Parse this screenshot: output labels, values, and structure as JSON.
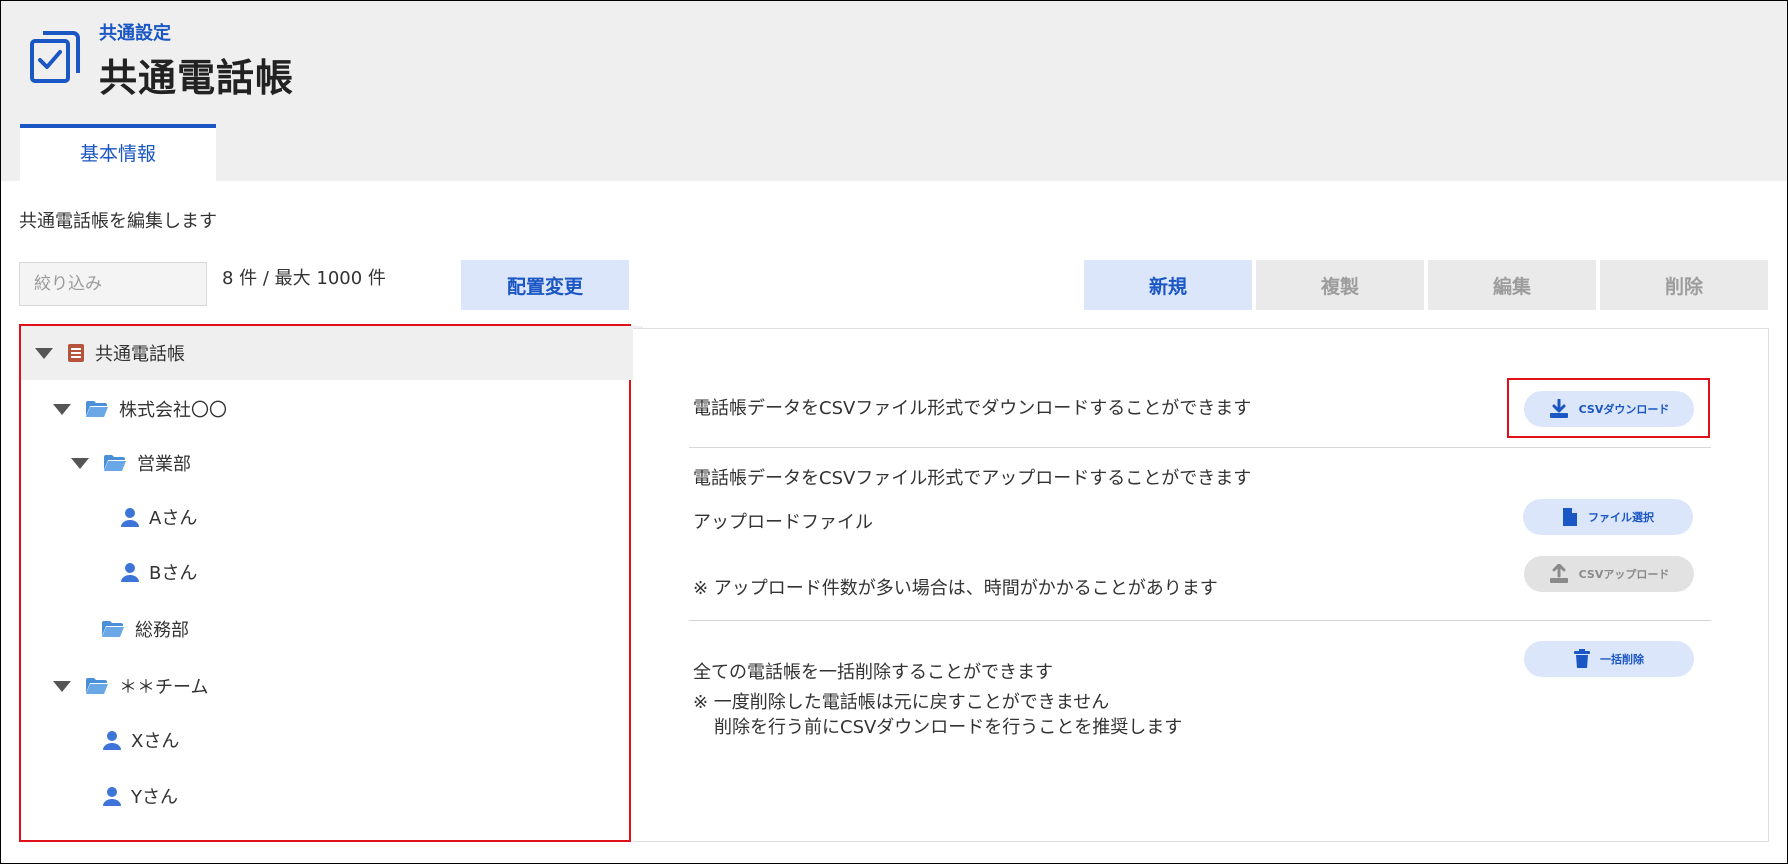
{
  "header": {
    "breadcrumb": "共通設定",
    "title": "共通電話帳"
  },
  "tabs": [
    {
      "label": "基本情報",
      "active": true
    }
  ],
  "description": "共通電話帳を編集します",
  "filter": {
    "placeholder": "絞り込み",
    "value": ""
  },
  "count_text": "8 件 / 最大 1000 件",
  "toolbar": {
    "rearrange_label": "配置変更",
    "new_label": "新規",
    "duplicate_label": "複製",
    "edit_label": "編集",
    "delete_label": "削除"
  },
  "tree": {
    "root": {
      "label": "共通電話帳",
      "icon": "book-icon"
    },
    "company": {
      "label": "株式会社〇〇",
      "icon": "folder-open-icon"
    },
    "sales": {
      "label": "営業部",
      "icon": "folder-open-icon"
    },
    "person_a": {
      "label": "Aさん",
      "icon": "person-icon"
    },
    "person_b": {
      "label": "Bさん",
      "icon": "person-icon"
    },
    "general_affairs": {
      "label": "総務部",
      "icon": "folder-open-icon"
    },
    "team": {
      "label": "＊＊チーム",
      "icon": "folder-open-icon"
    },
    "person_x": {
      "label": "Xさん",
      "icon": "person-icon"
    },
    "person_y": {
      "label": "Yさん",
      "icon": "person-icon"
    }
  },
  "panel": {
    "download_text": "電話帳データをCSVファイル形式でダウンロードすることができます",
    "download_button": "CSVダウンロード",
    "upload_text": "電話帳データをCSVファイル形式でアップロードすることができます",
    "upload_file_label": "アップロードファイル",
    "file_select_button": "ファイル選択",
    "upload_note": "※ アップロード件数が多い場合は、時間がかかることがあります",
    "upload_button": "CSVアップロード",
    "bulk_delete_text": "全ての電話帳を一括削除することができます",
    "bulk_delete_note1": "※ 一度削除した電話帳は元に戻すことができません",
    "bulk_delete_note2": "削除を行う前にCSVダウンロードを行うことを推奨します",
    "bulk_delete_button": "一括削除"
  },
  "colors": {
    "accent": "#1a56c4",
    "accent_light": "#dce6fb",
    "highlight": "#e0101a",
    "header_bg": "#efefef",
    "folder": "#4a90d9",
    "book": "#b5533c"
  }
}
